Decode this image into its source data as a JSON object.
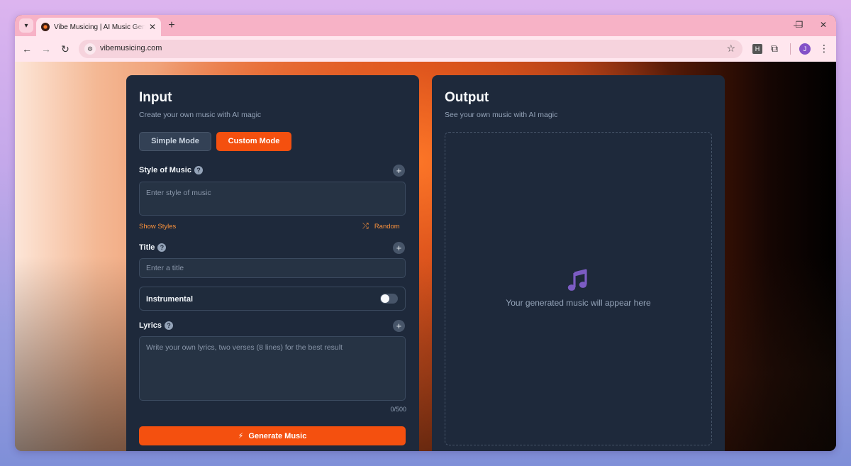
{
  "browser": {
    "tab_title": "Vibe Musicing | AI Music Generator",
    "url": "vibemusicing.com",
    "extension_label": "H",
    "profile_initial": "J"
  },
  "input_panel": {
    "title": "Input",
    "subtitle": "Create your own music with AI magic",
    "modes": {
      "simple": "Simple Mode",
      "custom": "Custom Mode",
      "selected": "Custom Mode"
    },
    "style": {
      "label": "Style of Music",
      "placeholder": "Enter style of music",
      "show_styles": "Show Styles",
      "random": "Random"
    },
    "title_field": {
      "label": "Title",
      "placeholder": "Enter a title"
    },
    "instrumental": {
      "label": "Instrumental",
      "enabled": false
    },
    "lyrics": {
      "label": "Lyrics",
      "placeholder": "Write your own lyrics, two verses (8 lines) for the best result",
      "counter": "0/500"
    },
    "generate_button": "Generate Music"
  },
  "output_panel": {
    "title": "Output",
    "subtitle": "See your own music with AI magic",
    "placeholder": "Your generated music will appear here"
  },
  "colors": {
    "accent": "#f4500f",
    "panel": "#1e293b",
    "link": "#fb923c",
    "music_icon": "#7c5cc4"
  }
}
